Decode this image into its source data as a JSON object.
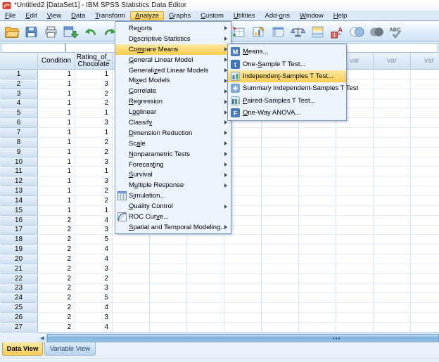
{
  "window_title": "*Untitled2 [DataSet1] - IBM SPSS Statistics Data Editor",
  "menu_bar": [
    {
      "label": "File",
      "m": 0
    },
    {
      "label": "Edit",
      "m": 0
    },
    {
      "label": "View",
      "m": 0
    },
    {
      "label": "Data",
      "m": 0
    },
    {
      "label": "Transform",
      "m": 0
    },
    {
      "label": "Analyze",
      "m": 0,
      "active": true
    },
    {
      "label": "Graphs",
      "m": 0
    },
    {
      "label": "Custom",
      "m": 0
    },
    {
      "label": "Utilities",
      "m": 0
    },
    {
      "label": "Add-ons",
      "m": 4
    },
    {
      "label": "Window",
      "m": 0
    },
    {
      "label": "Help",
      "m": 0
    }
  ],
  "toolbar_left": [
    {
      "name": "open-data-icon"
    },
    {
      "name": "save-icon"
    },
    {
      "name": "print-icon"
    },
    {
      "name": "recall-dialogs-icon"
    },
    {
      "name": "undo-icon"
    },
    {
      "name": "redo-icon"
    }
  ],
  "toolbar_right": [
    {
      "name": "goto-case-icon"
    },
    {
      "name": "goto-variable-icon"
    },
    {
      "name": "variables-icon"
    },
    {
      "name": "weight-cases-icon"
    },
    {
      "name": "split-file-icon"
    },
    {
      "name": "value-labels-icon"
    },
    {
      "name": "use-variable-sets-icon"
    },
    {
      "name": "show-all-variables-icon"
    },
    {
      "name": "spell-check-icon"
    }
  ],
  "analyze_menu": {
    "items": [
      {
        "label": "Reports",
        "m": 2,
        "sub": true
      },
      {
        "label": "Descriptive Statistics",
        "m": 1,
        "sub": true
      },
      {
        "label": "Compare Means",
        "m": 2,
        "sub": true,
        "highlighted": true
      },
      {
        "label": "General Linear Model",
        "m": 0,
        "sub": true
      },
      {
        "label": "Generalized Linear Models",
        "m": 8,
        "sub": true
      },
      {
        "label": "Mixed Models",
        "m": 2,
        "sub": true
      },
      {
        "label": "Correlate",
        "m": 0,
        "sub": true
      },
      {
        "label": "Regression",
        "m": 0,
        "sub": true
      },
      {
        "label": "Loglinear",
        "m": 1,
        "sub": true
      },
      {
        "label": "Classify",
        "m": 7,
        "sub": true
      },
      {
        "label": "Dimension Reduction",
        "m": 0,
        "sub": true
      },
      {
        "label": "Scale",
        "m": 2,
        "sub": true
      },
      {
        "label": "Nonparametric Tests",
        "m": 0,
        "sub": true
      },
      {
        "label": "Forecasting",
        "m": 7,
        "sub": true
      },
      {
        "label": "Survival",
        "m": 0,
        "sub": true
      },
      {
        "label": "Multiple Response",
        "m": 1,
        "sub": true
      },
      {
        "label": "Simulation...",
        "m": 1,
        "sub": false,
        "icon": "simulation-icon"
      },
      {
        "label": "Quality Control",
        "m": 0,
        "sub": true
      },
      {
        "label": "ROC Curve...",
        "m": 7,
        "sub": false,
        "icon": "roc-curve-icon"
      },
      {
        "label": "Spatial and Temporal Modeling...",
        "m": 0,
        "sub": true
      }
    ]
  },
  "compare_means_submenu": {
    "items": [
      {
        "label": "Means...",
        "m": 0,
        "icon": "means-icon"
      },
      {
        "label": "One-Sample T Test...",
        "m": 4,
        "icon": "one-sample-t-icon"
      },
      {
        "label": "Independent-Samples T Test...",
        "m": 10,
        "icon": "independent-samples-t-icon",
        "highlighted": true
      },
      {
        "label": "Summary Independent-Samples T Test",
        "m": -1,
        "icon": "summary-independent-t-icon"
      },
      {
        "label": "Paired-Samples T Test...",
        "m": 0,
        "icon": "paired-samples-t-icon"
      },
      {
        "label": "One-Way ANOVA...",
        "m": 0,
        "icon": "one-way-anova-icon"
      }
    ]
  },
  "grid": {
    "named_columns": [
      "Condition",
      "Rating_of_Chocolate"
    ],
    "var_label": "var",
    "var_columns": 9,
    "rows": [
      [
        1,
        1,
        1
      ],
      [
        2,
        1,
        3
      ],
      [
        3,
        1,
        2
      ],
      [
        4,
        1,
        2
      ],
      [
        5,
        1,
        1
      ],
      [
        6,
        1,
        3
      ],
      [
        7,
        1,
        1
      ],
      [
        8,
        1,
        2
      ],
      [
        9,
        1,
        2
      ],
      [
        10,
        1,
        3
      ],
      [
        11,
        1,
        1
      ],
      [
        12,
        1,
        3
      ],
      [
        13,
        1,
        2
      ],
      [
        14,
        1,
        2
      ],
      [
        15,
        1,
        1
      ],
      [
        16,
        2,
        4
      ],
      [
        17,
        2,
        3
      ],
      [
        18,
        2,
        5
      ],
      [
        19,
        2,
        4
      ],
      [
        20,
        2,
        4
      ],
      [
        21,
        2,
        3
      ],
      [
        22,
        2,
        2
      ],
      [
        23,
        2,
        3
      ],
      [
        24,
        2,
        5
      ],
      [
        25,
        2,
        4
      ],
      [
        26,
        2,
        3
      ],
      [
        27,
        2,
        4
      ]
    ]
  },
  "scrollbar": {
    "left_arrow": "◀"
  },
  "tabs": {
    "data_view": "Data View",
    "variable_view": "Variable View"
  },
  "colors": {
    "highlight_gold": "#fbce55",
    "menu_background": "#edf4fc",
    "menu_border": "#7a9cc4",
    "grid_line": "#d7e5f3",
    "header_gradient_top": "#eaf2fb",
    "header_gradient_bottom": "#d2e2f2",
    "var_header_text": "#7e93ac"
  }
}
